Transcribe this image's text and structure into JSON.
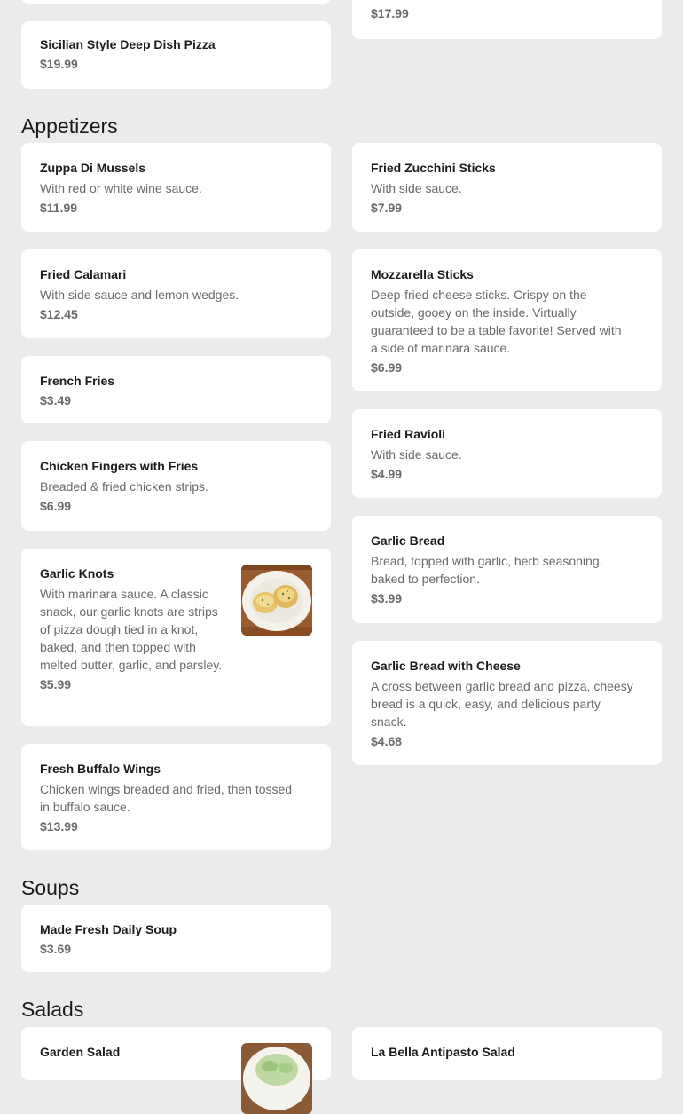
{
  "pizza": {
    "deep_dish": {
      "name": "Sicilian Style Deep Dish Pizza",
      "price": "$19.99"
    },
    "right_partial": {
      "price": "$17.99"
    }
  },
  "appetizers": {
    "title": "Appetizers",
    "items": [
      {
        "name": "Zuppa Di Mussels",
        "desc": "With red or white wine sauce.",
        "price": "$11.99"
      },
      {
        "name": "Fried Zucchini Sticks",
        "desc": "With side sauce.",
        "price": "$7.99"
      },
      {
        "name": "Fried Calamari",
        "desc": "With side sauce and lemon wedges.",
        "price": "$12.45"
      },
      {
        "name": "Mozzarella Sticks",
        "desc": "Deep-fried cheese sticks. Crispy on the outside, gooey on the inside. Virtually guaranteed to be a table favorite! Served with a side of marinara sauce.",
        "price": "$6.99"
      },
      {
        "name": "French Fries",
        "price": "$3.49"
      },
      {
        "name": "Fried Ravioli",
        "desc": "With side sauce.",
        "price": "$4.99"
      },
      {
        "name": "Chicken Fingers with Fries",
        "desc": "Breaded & fried chicken strips.",
        "price": "$6.99"
      },
      {
        "name": "Garlic Bread",
        "desc": "Bread, topped with garlic, herb seasoning, baked to perfection.",
        "price": "$3.99"
      },
      {
        "name": "Garlic Knots",
        "desc": "With marinara sauce. A classic snack, our garlic knots are strips of pizza dough tied in a knot, baked, and then topped with melted butter, garlic, and parsley.",
        "price": "$5.99"
      },
      {
        "name": "Garlic Bread with Cheese",
        "desc": "A cross between garlic bread and pizza, cheesy bread is a quick, easy, and delicious party snack.",
        "price": "$4.68"
      },
      {
        "name": "Fresh Buffalo Wings",
        "desc": "Chicken wings breaded and fried, then tossed in buffalo sauce.",
        "price": "$13.99"
      }
    ]
  },
  "soups": {
    "title": "Soups",
    "items": [
      {
        "name": "Made Fresh Daily Soup",
        "price": "$3.69"
      }
    ]
  },
  "salads": {
    "title": "Salads",
    "items": [
      {
        "name": "Garden Salad"
      },
      {
        "name": "La Bella Antipasto Salad"
      }
    ]
  },
  "colors": {
    "page_bg": "#ebebeb",
    "card_bg": "#ffffff",
    "name_text": "#1c1c1c",
    "desc_text": "#6a6a6a"
  },
  "icons": {
    "garlic_knots": "garlic-knots-photo",
    "garden_salad": "garden-salad-photo"
  }
}
